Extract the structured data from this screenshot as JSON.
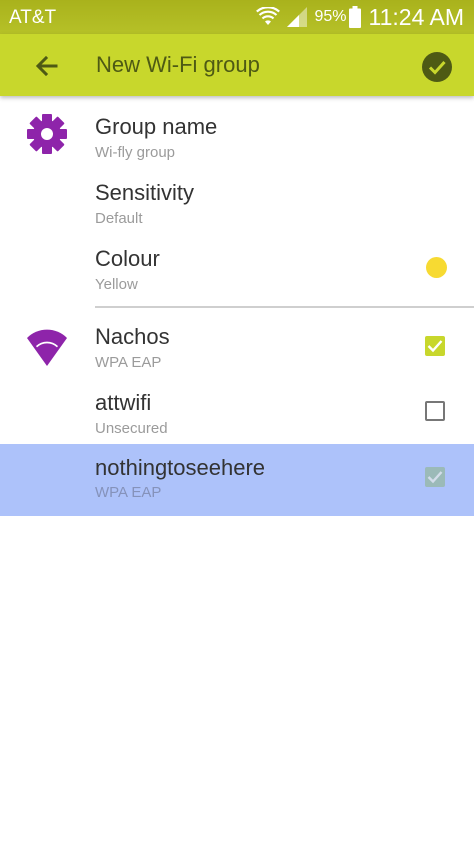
{
  "status_bar": {
    "carrier": "AT&T",
    "battery_percent": "95%",
    "time": "11:24 AM"
  },
  "app_bar": {
    "title": "New Wi-Fi group",
    "back_icon": "arrow-left-icon",
    "confirm_icon": "check-circle-icon"
  },
  "settings": [
    {
      "title": "Group name",
      "subtitle": "Wi-fly group",
      "icon": "gear-icon"
    },
    {
      "title": "Sensitivity",
      "subtitle": "Default"
    },
    {
      "title": "Colour",
      "subtitle": "Yellow",
      "swatch_color": "#f7da32"
    }
  ],
  "networks": [
    {
      "ssid": "Nachos",
      "security": "WPA EAP",
      "checked": true,
      "icon": "wifi-icon"
    },
    {
      "ssid": "attwifi",
      "security": "Unsecured",
      "checked": false
    },
    {
      "ssid": "nothingtoseehere",
      "security": "WPA EAP",
      "checked": true,
      "selected": true
    }
  ],
  "colors": {
    "status_bar": "#b3be26",
    "app_bar": "#c8d72c",
    "accent_icon": "#8e24aa",
    "checkbox_checked": "#c8d72c",
    "selection_highlight": "#adc2fa",
    "colour_swatch": "#f7da32"
  }
}
